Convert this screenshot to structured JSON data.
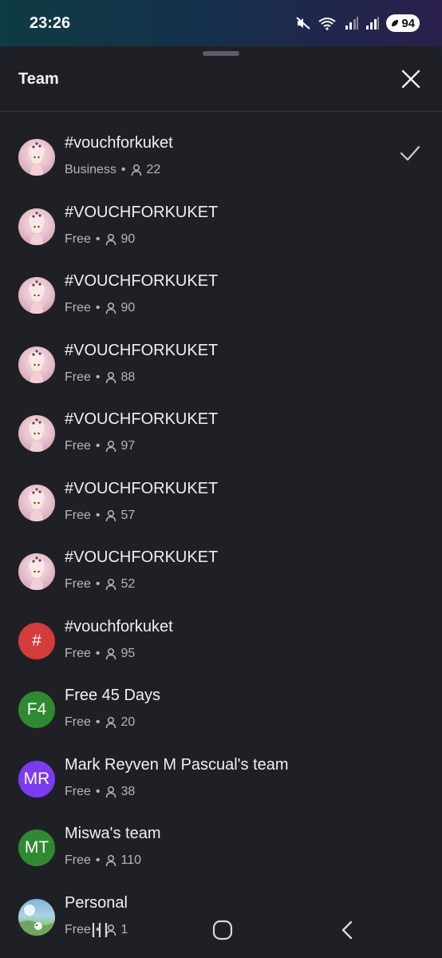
{
  "status_bar": {
    "time": "23:26",
    "battery": "94",
    "network": "5"
  },
  "sheet": {
    "title": "Team"
  },
  "teams": [
    {
      "name": "#vouchforkuket",
      "plan": "Business",
      "members": "22",
      "avatar": {
        "type": "image",
        "icon": "doll-avatar"
      },
      "selected": true
    },
    {
      "name": "#VOUCHFORKUKET",
      "plan": "Free",
      "members": "90",
      "avatar": {
        "type": "image",
        "icon": "doll-avatar"
      }
    },
    {
      "name": "#VOUCHFORKUKET",
      "plan": "Free",
      "members": "90",
      "avatar": {
        "type": "image",
        "icon": "doll-avatar"
      }
    },
    {
      "name": "#VOUCHFORKUKET",
      "plan": "Free",
      "members": "88",
      "avatar": {
        "type": "image",
        "icon": "doll-avatar"
      }
    },
    {
      "name": "#VOUCHFORKUKET",
      "plan": "Free",
      "members": "97",
      "avatar": {
        "type": "image",
        "icon": "doll-avatar"
      }
    },
    {
      "name": "#VOUCHFORKUKET",
      "plan": "Free",
      "members": "57",
      "avatar": {
        "type": "image",
        "icon": "doll-avatar"
      }
    },
    {
      "name": "#VOUCHFORKUKET",
      "plan": "Free",
      "members": "52",
      "avatar": {
        "type": "image",
        "icon": "doll-avatar"
      }
    },
    {
      "name": "#vouchforkuket",
      "plan": "Free",
      "members": "95",
      "avatar": {
        "type": "initials",
        "text": "#",
        "color": "#d43b3b"
      }
    },
    {
      "name": "Free 45 Days",
      "plan": "Free",
      "members": "20",
      "avatar": {
        "type": "initials",
        "text": "F4",
        "color": "#2f8a2f"
      }
    },
    {
      "name": "Mark Reyven M Pascual's team",
      "plan": "Free",
      "members": "38",
      "avatar": {
        "type": "initials",
        "text": "MR",
        "color": "#7b3cf0"
      }
    },
    {
      "name": "Miswa's team",
      "plan": "Free",
      "members": "110",
      "avatar": {
        "type": "initials",
        "text": "MT",
        "color": "#2f8a2f"
      }
    },
    {
      "name": "Personal",
      "plan": "Free",
      "members": "1",
      "avatar": {
        "type": "photo",
        "icon": "landscape-avatar"
      }
    }
  ],
  "colors": {
    "background": "#1f2025",
    "text": "#f0f0f2",
    "muted": "#b4b6bd",
    "divider": "#34363d"
  },
  "nav_bar": {
    "icons": [
      "recents-icon",
      "home-icon",
      "back-icon"
    ]
  }
}
